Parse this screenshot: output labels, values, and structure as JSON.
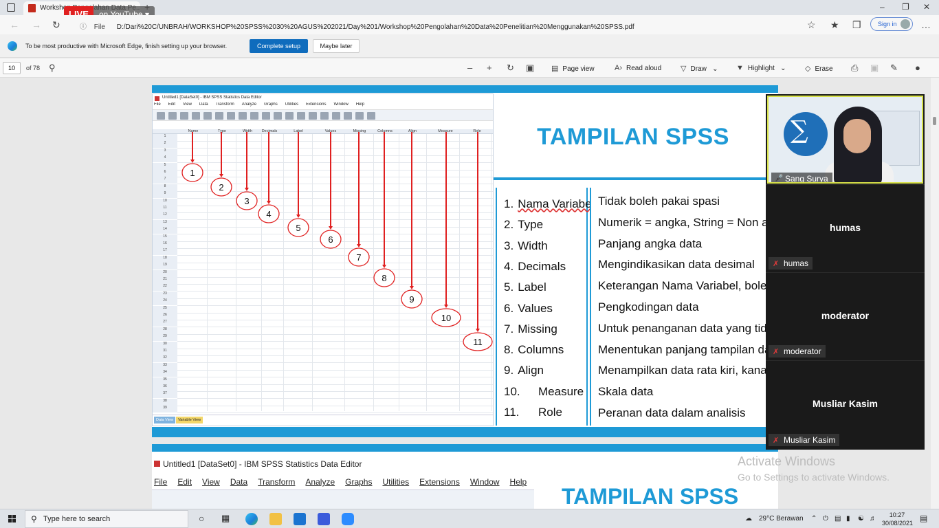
{
  "browser": {
    "tab_title": "Workshop Pengolahan Data Pe...",
    "live_badge": "LIVE",
    "youtube_badge": "on YouTube",
    "url_prefix": "File",
    "url": "D:/Dari%20C/UNBRAH/WORKSHOP%20SPSS%2030%20AGUS%202021/Day%201/Workshop%20Pengolahan%20Data%20Penelitian%20Menggunakan%20SPSS.pdf",
    "signin": "Sign in"
  },
  "infobar": {
    "message": "To be most productive with Microsoft Edge, finish setting up your browser.",
    "primary_button": "Complete setup",
    "secondary_button": "Maybe later"
  },
  "pdf_toolbar": {
    "page_number": "10",
    "page_total": "of 78",
    "page_view": "Page view",
    "read_aloud": "Read aloud",
    "draw": "Draw",
    "highlight": "Highlight",
    "erase": "Erase"
  },
  "slide1": {
    "spss_window_title": "Untitled1 [DataSet0] - IBM SPSS Statistics Data Editor",
    "spss_menu": [
      "File",
      "Edit",
      "View",
      "Data",
      "Transform",
      "Analyze",
      "Graphs",
      "Utilities",
      "Extensions",
      "Window",
      "Help"
    ],
    "spss_columns": [
      "Name",
      "Type",
      "Width",
      "Decimals",
      "Label",
      "Values",
      "Missing",
      "Columns",
      "Align",
      "Measure",
      "Role"
    ],
    "spss_tabs": [
      "Data View",
      "Variable View"
    ],
    "callout_numbers": [
      "1",
      "2",
      "3",
      "4",
      "5",
      "6",
      "7",
      "8",
      "9",
      "10",
      "11"
    ],
    "title": "TAMPILAN SPSS",
    "attributes": [
      {
        "num": "1.",
        "name": "Nama Variabel"
      },
      {
        "num": "2.",
        "name": "Type"
      },
      {
        "num": "3.",
        "name": "Width"
      },
      {
        "num": "4.",
        "name": "Decimals"
      },
      {
        "num": "5.",
        "name": "Label"
      },
      {
        "num": "6.",
        "name": "Values"
      },
      {
        "num": "7.",
        "name": "Missing"
      },
      {
        "num": "8.",
        "name": "Columns"
      },
      {
        "num": "9.",
        "name": "Align"
      },
      {
        "num": "10.",
        "name": "Measure"
      },
      {
        "num": "11.",
        "name": "Role"
      }
    ],
    "descriptions": [
      "Tidak boleh pakai spasi",
      "Numerik = angka, String = Non angka",
      "Panjang angka data",
      "Mengindikasikan data desimal",
      "Keterangan Nama Variabel, boleh spasi",
      "Pengkodingan data",
      "Untuk penanganan data yang tidak ada",
      "Menentukan panjang tampilan data view",
      "Menampilkan data rata kiri, kanan, tengah",
      "Skala data",
      "Peranan data dalam analisis"
    ]
  },
  "slide2": {
    "spss_window_title": "Untitled1 [DataSet0] - IBM SPSS Statistics Data Editor",
    "spss_menu": [
      "File",
      "Edit",
      "View",
      "Data",
      "Transform",
      "Analyze",
      "Graphs",
      "Utilities",
      "Extensions",
      "Window",
      "Help"
    ],
    "title": "TAMPILAN SPSS"
  },
  "meeting": {
    "participants": [
      {
        "name": "Sang Surya",
        "video": true
      },
      {
        "name": "humas",
        "video": false,
        "muted": true
      },
      {
        "name": "moderator",
        "video": false,
        "muted": true
      },
      {
        "name": "Musliar Kasim",
        "video": false,
        "muted": true
      }
    ]
  },
  "watermark": {
    "line1": "Activate Windows",
    "line2": "Go to Settings to activate Windows."
  },
  "taskbar": {
    "search_placeholder": "Type here to search",
    "weather": "29°C  Berawan",
    "time": "10:27",
    "date": "30/08/2021"
  },
  "colors": {
    "accent_blue": "#1e9ad6",
    "arrow_red": "#e02020",
    "edge_primary": "#0f6cbd"
  }
}
